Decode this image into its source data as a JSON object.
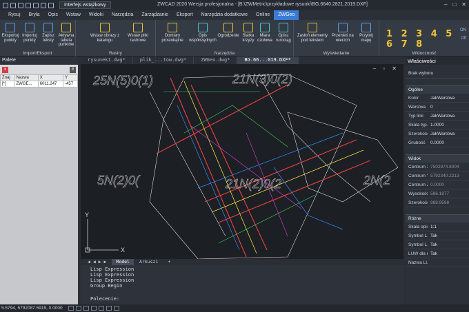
{
  "titlebar": {
    "workspace": "Interfejs wstążkowy",
    "title": "ZWCAD 2020 Wersja profesjonalna - [B:\\ZWMetric\\przykładowe rysunki\\BG.6640.2821.2019.DXF]"
  },
  "menu": [
    "Rysuj",
    "Bryła",
    "Opis",
    "Wstaw",
    "Widoki",
    "Narzędzia",
    "Zarządzanie",
    "Eksport",
    "Narzędzia dodatkowe",
    "Online",
    "ZWGeo"
  ],
  "ribbon": {
    "import_export": {
      "label": "Import/Eksport",
      "buttons": [
        "Eksportuj punkty",
        "Importuj punkty",
        "Zapisz teksty",
        "Aktywna tabela punktów"
      ]
    },
    "rastry": {
      "label": "Rastry",
      "buttons": [
        "Wstaw obrazy z katalogu",
        "Wstaw pliki rastrowe"
      ]
    },
    "narzedzia": {
      "label": "Narzędzia",
      "buttons": [
        "Domiary prostokątne",
        "Opis współrzędnych",
        "Ogrodzenie",
        "Siatka krzyży",
        "Miara czołowa",
        "Opisz rurociąg"
      ]
    },
    "wyswietlanie": {
      "label": "Wyświetlanie",
      "buttons": [
        "Zasłoń elementy pod tekstem",
        "Przenieś na wierzch",
        "Przytnij mapę"
      ]
    },
    "widocznosc": {
      "label": "Widoczność",
      "numbers": "1 2 3 4 5 6 7 8",
      "on": "ON",
      "off": "Off"
    }
  },
  "palette": {
    "title": "Palete",
    "columns": [
      "Znaj",
      "Nazwa",
      "X",
      "Y"
    ],
    "row": [
      "[*]",
      "ZWGE...",
      "6011.247",
      "-457"
    ]
  },
  "doc_tabs": [
    "rysunek1.dwg*",
    "plik_...tow.dwg*",
    "ZWGeo.dwg*",
    "BG.66...019.DXF*"
  ],
  "canvas_labels": [
    "25N(5)0(1)",
    "21N(3)0(2)",
    "5N(2)0(",
    "21N(2)0(2",
    "2N(2"
  ],
  "layout_tabs": [
    "Model",
    "Arkusz1",
    "+"
  ],
  "command": {
    "history": [
      "Lisp Expression",
      "Lisp Expression",
      "Lisp Expression",
      "Group Begin"
    ],
    "prompt": "Polecenie:"
  },
  "properties": {
    "title": "Właściwości",
    "selection": "Brak wyboru",
    "general_label": "Ogólne",
    "general": [
      {
        "k": "Kolor",
        "v": "JakWarstwa"
      },
      {
        "k": "Warstwa",
        "v": "0"
      },
      {
        "k": "Typ linii",
        "v": "JakWarstwa"
      },
      {
        "k": "Skala typ...",
        "v": "1.0000"
      },
      {
        "k": "Szerokość...",
        "v": "JakWarstwa"
      },
      {
        "k": "Grubość",
        "v": "0.0000"
      }
    ],
    "view_label": "Widok",
    "view": [
      {
        "k": "Centrum X",
        "v": "7502974.8004"
      },
      {
        "k": "Centrum Y",
        "v": "5792340.2213"
      },
      {
        "k": "Centrum Z",
        "v": "0.0000"
      },
      {
        "k": "Wysokość",
        "v": "586.1877"
      },
      {
        "k": "Szerokość",
        "v": "988.9598"
      }
    ],
    "misc_label": "Różne",
    "misc": [
      {
        "k": "Skala opis...",
        "v": "1:1"
      },
      {
        "k": "Symbol L...",
        "v": "Tak"
      },
      {
        "k": "Symbol L...",
        "v": "Tak"
      },
      {
        "k": "LUW dla r...",
        "v": "Tak"
      },
      {
        "k": "Nazwa LU...",
        "v": ""
      }
    ]
  },
  "status": {
    "coords": "5.5794, 5792087.5919, 0.0000"
  },
  "colors": {
    "accent": "#3a7bd5",
    "yellow": "#f2c233",
    "canvas": "#1c1f24"
  }
}
